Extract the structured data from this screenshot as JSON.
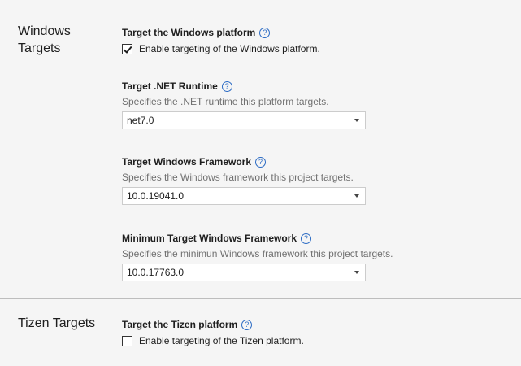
{
  "windows": {
    "section_title": "Windows Targets",
    "platform": {
      "label": "Target the Windows platform",
      "checkbox_label": "Enable targeting of the Windows platform.",
      "checked": true
    },
    "runtime": {
      "label": "Target .NET Runtime",
      "description": "Specifies the .NET runtime this platform targets.",
      "value": "net7.0"
    },
    "framework": {
      "label": "Target Windows Framework",
      "description": "Specifies the Windows framework this project targets.",
      "value": "10.0.19041.0"
    },
    "min_framework": {
      "label": "Minimum Target Windows Framework",
      "description": "Specifies the minimun Windows framework this project targets.",
      "value": "10.0.17763.0"
    }
  },
  "tizen": {
    "section_title": "Tizen Targets",
    "platform": {
      "label": "Target the Tizen platform",
      "checkbox_label": "Enable targeting of the Tizen platform.",
      "checked": false
    }
  },
  "icons": {
    "help": "?"
  }
}
